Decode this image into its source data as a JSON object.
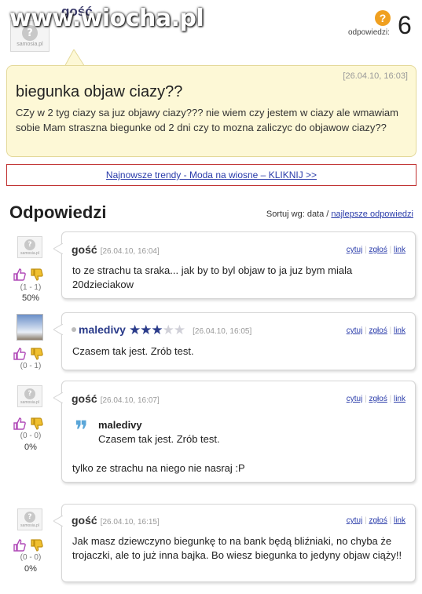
{
  "header": {
    "author": "gość",
    "avatar_label": "samosia.pl",
    "watermark": "www.wiocha.pl",
    "answers_label": "odpowiedzi:",
    "answers_count": "6"
  },
  "question": {
    "date": "[26.04.10, 16:03]",
    "title": "biegunka objaw ciazy??",
    "body": "CZy w 2 tyg ciazy sa juz objawy ciazy??? nie wiem czy jestem w ciazy ale wmawiam sobie Mam straszna biegunke od 2 dni czy to mozna zaliczyc do objawow ciazy??"
  },
  "trend_link": "Najnowsze trendy - Moda na wiosne – KLIKNIJ >>",
  "answers_section": {
    "title": "Odpowiedzi",
    "sort_label": "Sortuj wg: data /",
    "sort_link": "najlepsze odpowiedzi"
  },
  "action_links": {
    "cite": "cytuj",
    "report": "zgłoś",
    "link": "link"
  },
  "answers": [
    {
      "author": "gość",
      "date": "[26.04.10, 16:04]",
      "votes": "(1 - 1)",
      "percent": "50%",
      "text": "to ze strachu ta sraka... jak by to byl objaw to ja juz bym miala 20dzieciakow"
    },
    {
      "author": "maledivy",
      "date": "[26.04.10, 16:05]",
      "votes": "(0 - 1)",
      "rating": 3,
      "rating_max": 5,
      "text": "Czasem tak jest. Zrób test."
    },
    {
      "author": "gość",
      "date": "[26.04.10, 16:07]",
      "votes": "(0 - 0)",
      "percent": "0%",
      "quote_author": "maledivy",
      "quote_text": "Czasem tak jest. Zrób test.",
      "text": "tylko ze strachu na niego nie nasraj :P"
    },
    {
      "author": "gość",
      "date": "[26.04.10, 16:15]",
      "votes": "(0 - 0)",
      "percent": "0%",
      "text": "Jak masz dziewczyno biegunkę to na bank będą bliźniaki, no chyba że trojaczki, ale to już inna bajka. Bo wiesz biegunka to jedyny objaw ciąży!!"
    }
  ],
  "colors": {
    "question_bg": "#fdf8d6",
    "link": "#2a3caa",
    "thumb_up": "#b04ab8",
    "thumb_down": "#e0b020",
    "trend_border": "#c03030"
  }
}
